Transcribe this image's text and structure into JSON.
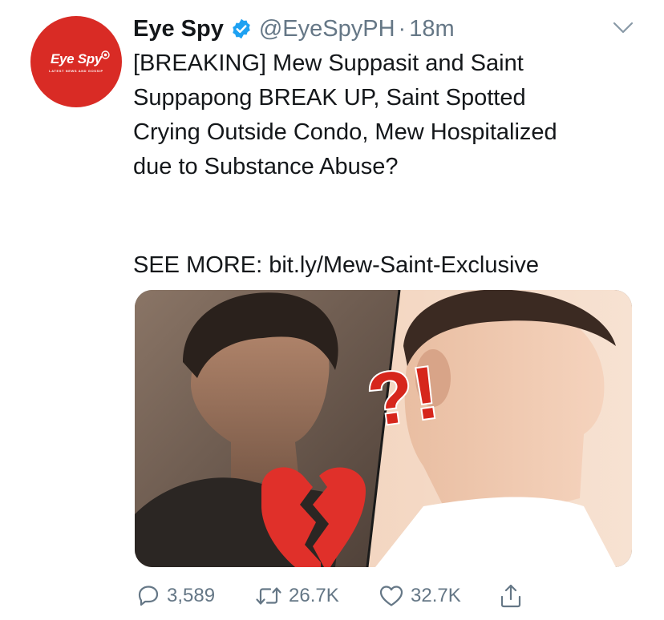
{
  "account": {
    "display_name": "Eye Spy",
    "handle": "@EyeSpyPH",
    "separator": "·",
    "time": "18m",
    "avatar_logo": "Eye Spy",
    "avatar_tagline": "LATEST NEWS AND GOSSIP"
  },
  "tweet": {
    "lines": [
      "[BREAKING] Mew Suppasit and Saint",
      "Suppapong BREAK UP, Saint Spotted",
      "Crying Outside Condo, Mew Hospitalized",
      "due to Substance Abuse?"
    ],
    "see_more": "SEE MORE: bit.ly/Mew-Saint-Exclusive",
    "media_overlay_text": "?!",
    "media_emoji": "💔"
  },
  "actions": {
    "reply_count": "3,589",
    "retweet_count": "26.7K",
    "like_count": "32.7K"
  },
  "colors": {
    "brand_red": "#d92b25",
    "verified_blue": "#1da1f2",
    "secondary_text": "#657786",
    "primary_text": "#14171a"
  },
  "icons": [
    "verified-badge-icon",
    "caret-down-icon",
    "reply-icon",
    "retweet-icon",
    "like-icon",
    "share-icon"
  ]
}
